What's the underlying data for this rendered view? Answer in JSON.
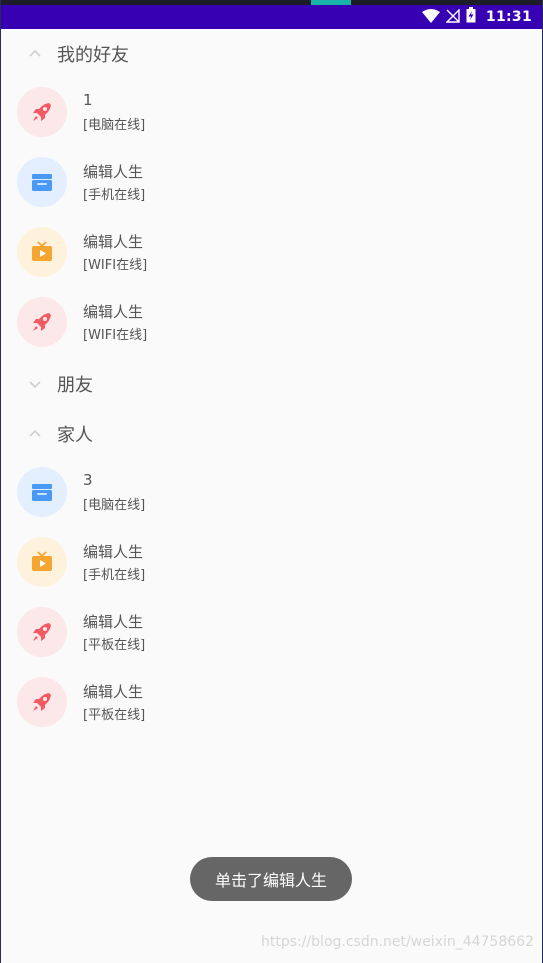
{
  "status_bar": {
    "time": "11:31",
    "icons": [
      "wifi-icon",
      "no-signal-icon",
      "battery-charging-icon"
    ],
    "bar_color": "#3700b3"
  },
  "groups": [
    {
      "name": "我的好友",
      "expanded": true,
      "children": [
        {
          "name": "1",
          "status": "[电脑在线]",
          "icon": "rocket-icon"
        },
        {
          "name": "编辑人生",
          "status": "[手机在线]",
          "icon": "clapperboard-icon"
        },
        {
          "name": "编辑人生",
          "status": "[WIFI在线]",
          "icon": "tv-play-icon"
        },
        {
          "name": "编辑人生",
          "status": "[WIFI在线]",
          "icon": "rocket-icon"
        }
      ]
    },
    {
      "name": "朋友",
      "expanded": false,
      "children": []
    },
    {
      "name": "家人",
      "expanded": true,
      "children": [
        {
          "name": "3",
          "status": "[电脑在线]",
          "icon": "clapperboard-icon"
        },
        {
          "name": "编辑人生",
          "status": "[手机在线]",
          "icon": "tv-play-icon"
        },
        {
          "name": "编辑人生",
          "status": "[平板在线]",
          "icon": "rocket-icon"
        },
        {
          "name": "编辑人生",
          "status": "[平板在线]",
          "icon": "rocket-icon"
        }
      ]
    }
  ],
  "toast": {
    "text": "单击了编辑人生"
  },
  "watermark": {
    "text": "https://blog.csdn.net/weixin_44758662"
  },
  "colors": {
    "rocket_bg": "#fde8e9",
    "rocket_fg": "#f25a64",
    "clapper_bg": "#e3efff",
    "clapper_fg": "#4a9af5",
    "tv_bg": "#fff2dc",
    "tv_fg": "#f6a531"
  }
}
